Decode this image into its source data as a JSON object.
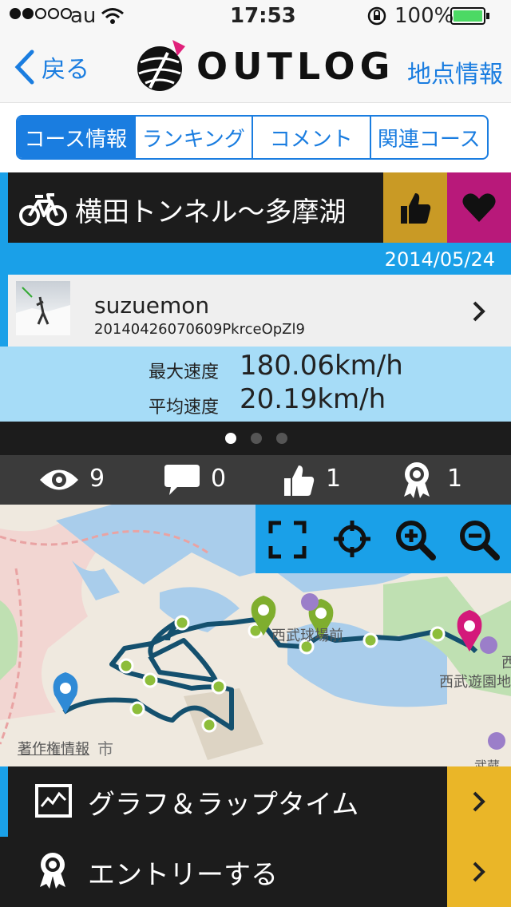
{
  "status": {
    "carrier": "au",
    "time": "17:53",
    "battery": "100%"
  },
  "nav": {
    "back": "戻る",
    "logo": "OUTLOG",
    "right": "地点情報"
  },
  "tabs": [
    "コース情報",
    "ランキング",
    "コメント",
    "関連コース"
  ],
  "course": {
    "title": "横田トンネル〜多摩湖",
    "date": "2014/05/24"
  },
  "user": {
    "name": "suzuemon",
    "id": "20140426070609PkrceOpZl9"
  },
  "speed": {
    "max_label": "最大速度",
    "max_value": "180.06km/h",
    "avg_label": "平均速度",
    "avg_value": "20.19km/h"
  },
  "stats": {
    "views": "9",
    "comments": "0",
    "likes": "1",
    "entries": "1"
  },
  "map": {
    "credit": "著作権情報",
    "labels": [
      "西武球場前",
      "西武遊園地",
      "市",
      "西",
      "武蔵大"
    ]
  },
  "menu": [
    "グラフ＆ラップタイム",
    "エントリーする"
  ],
  "colors": {
    "accent": "#1a7de0",
    "cyan": "#1aa0e8",
    "like": "#c99a25",
    "fav": "#b8197a",
    "route": "#14506e"
  }
}
